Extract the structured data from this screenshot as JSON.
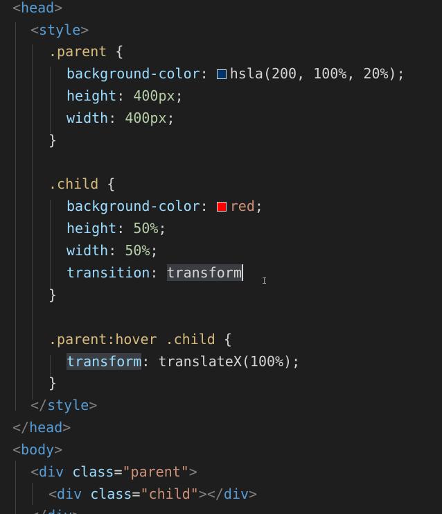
{
  "code": {
    "l1": {
      "tag": "head"
    },
    "l2": {
      "tag": "style"
    },
    "l3": {
      "selector": ".parent",
      "brace": " {"
    },
    "l4": {
      "prop": "background-color",
      "value": "hsla(200, 100%, 20%)",
      "swatch_color": "#003366"
    },
    "l5": {
      "prop": "height",
      "value": "400px"
    },
    "l6": {
      "prop": "width",
      "value": "400px"
    },
    "l7": {
      "brace": "}"
    },
    "l9": {
      "selector": ".child",
      "brace": " {"
    },
    "l10": {
      "prop": "background-color",
      "value": "red",
      "swatch_color": "#ff0000"
    },
    "l11": {
      "prop": "height",
      "value": "50%"
    },
    "l12": {
      "prop": "width",
      "value": "50%"
    },
    "l13": {
      "prop": "transition",
      "value": "transform"
    },
    "l14": {
      "brace": "}"
    },
    "l16": {
      "selector": ".parent:hover .child",
      "brace": " {"
    },
    "l17": {
      "prop": "transform",
      "value": "translateX(100%)"
    },
    "l18": {
      "brace": "}"
    },
    "l19": {
      "tag": "style"
    },
    "l20": {
      "tag": "head"
    },
    "l21": {
      "tag": "body"
    },
    "l22": {
      "tag": "div",
      "attr": "class",
      "attr_value": "\"parent\""
    },
    "l23": {
      "tag": "div",
      "attr": "class",
      "attr_value": "\"child\"",
      "close_tag": "div"
    },
    "l24": {
      "tag": "div"
    }
  },
  "colors": {
    "background": "#1e1e1e",
    "tag": "#569cd6",
    "attribute": "#9cdcfe",
    "string": "#ce9178",
    "selector": "#d7ba7d",
    "number": "#b5cea8"
  }
}
